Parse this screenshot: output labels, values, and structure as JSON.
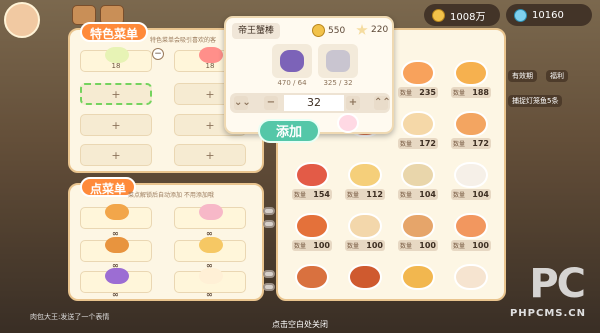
{
  "hud": {
    "money_1": "1008万",
    "money_2": "10160"
  },
  "featured_menu": {
    "title": "特色菜单",
    "hint": "特色菜单会吸引喜欢的客",
    "slots": [
      {
        "count": "18",
        "color": "#e7f3b5"
      },
      {
        "count": "18",
        "color": "#ff8f8a"
      }
    ],
    "empty_label": "+"
  },
  "order_menu": {
    "title": "点菜单",
    "hint": "菜点解锁后自动添加 不用添加哦",
    "slot_count": "∞",
    "colors": [
      "#f2a64a",
      "#f7b8c8",
      "#e8943e",
      "#f6c864",
      "#9c6dd3",
      "#fff0d6"
    ]
  },
  "recipe_popup": {
    "name": "帝王蟹棒",
    "coin_cost": "550",
    "star_cost": "220",
    "ingredients": [
      {
        "count": "470 / 64",
        "color": "#7c63b8"
      },
      {
        "count": "325 / 32",
        "color": "#c9c5d0"
      }
    ],
    "quantity": "32",
    "add_label": "添加",
    "minus": "−",
    "plus": "+",
    "down": "⌄⌄",
    "up": "⌃⌃"
  },
  "dish_grid": {
    "label": "数量",
    "rows": [
      [
        {
          "v": "",
          "c": "#f0a160"
        },
        {
          "v": "235",
          "c": "#f8a25c"
        },
        {
          "v": "188",
          "c": "#f6b14f"
        }
      ],
      [
        {
          "v": "",
          "c": "#e57b56"
        },
        {
          "v": "172",
          "c": "#f5d8a8"
        },
        {
          "v": "172",
          "c": "#f3a561"
        }
      ],
      [
        {
          "v": "154",
          "c": "#e35b47"
        },
        {
          "v": "112",
          "c": "#f5cf7a"
        },
        {
          "v": "104",
          "c": "#e9d6ab"
        },
        {
          "v": "104",
          "c": "#f6f0e8"
        }
      ],
      [
        {
          "v": "100",
          "c": "#e4713a"
        },
        {
          "v": "100",
          "c": "#f3d7ab"
        },
        {
          "v": "100",
          "c": "#e6a56a"
        },
        {
          "v": "100",
          "c": "#f2975f"
        }
      ],
      [
        {
          "v": "",
          "c": "#d9713f"
        },
        {
          "v": "",
          "c": "#cf5a2f"
        },
        {
          "v": "",
          "c": "#f2b74f"
        },
        {
          "v": "",
          "c": "#f6e4d0"
        }
      ]
    ]
  },
  "background": {
    "tag_1": "有效期",
    "tag_2": "福利",
    "tag_3": "捕捉灯笼鱼5条"
  },
  "bottom": {
    "close_hint": "点击空白处关闭",
    "chat": "肉包大王:发送了一个表情"
  },
  "watermark": {
    "logo": "PC",
    "site": "PHPCMS.CN"
  }
}
